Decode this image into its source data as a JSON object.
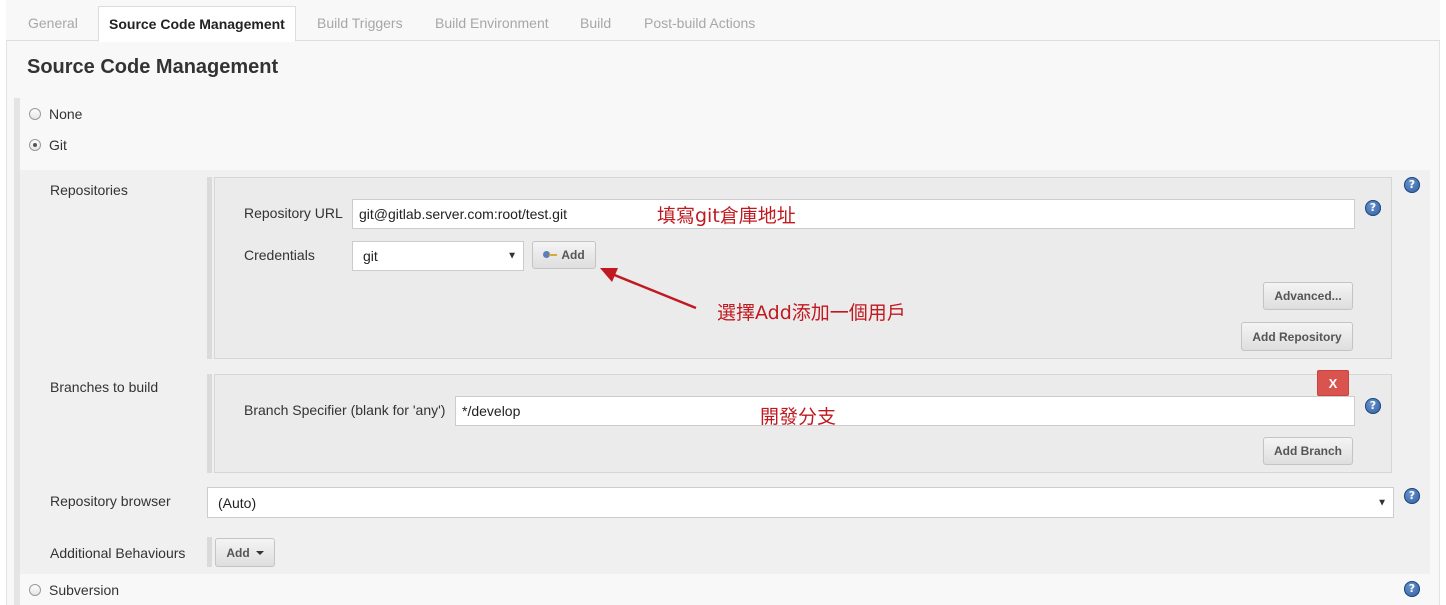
{
  "tabs": [
    {
      "label": "General"
    },
    {
      "label": "Source Code Management"
    },
    {
      "label": "Build Triggers"
    },
    {
      "label": "Build Environment"
    },
    {
      "label": "Build"
    },
    {
      "label": "Post-build Actions"
    }
  ],
  "active_tab": "Source Code Management",
  "section_title": "Source Code Management",
  "scm_options": {
    "none": "None",
    "git": "Git",
    "subversion": "Subversion",
    "selected": "Git"
  },
  "repositories": {
    "label": "Repositories",
    "url_label": "Repository URL",
    "url_value": "git@gitlab.server.com:root/test.git",
    "credentials_label": "Credentials",
    "credentials_value": "git",
    "add_button": "Add",
    "advanced_button": "Advanced...",
    "add_repository_button": "Add Repository"
  },
  "branches": {
    "label": "Branches to build",
    "specifier_label": "Branch Specifier (blank for 'any')",
    "specifier_value": "*/develop",
    "delete_button": "X",
    "add_branch_button": "Add Branch"
  },
  "repository_browser": {
    "label": "Repository browser",
    "value": "(Auto)"
  },
  "additional_behaviours": {
    "label": "Additional Behaviours",
    "add_button": "Add"
  },
  "annotations": {
    "url_note": "填寫git倉庫地址",
    "add_note": "選擇Add添加一個用戶",
    "branch_note": "開發分支"
  },
  "colors": {
    "annotation": "#c0191f",
    "delete_button": "#d9534f",
    "help_icon": "#2c5c9e"
  },
  "icons": {
    "help": "help-icon",
    "key": "key-icon",
    "dropdown": "chevron-down-icon"
  }
}
